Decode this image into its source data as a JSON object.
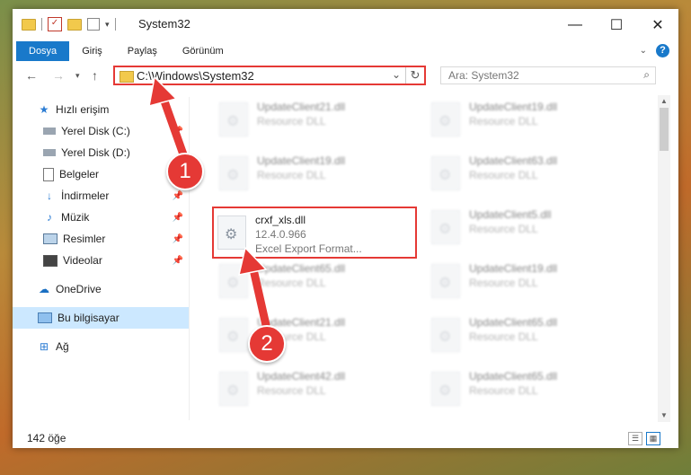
{
  "titlebar": {
    "title": "System32",
    "minimize": "—",
    "maximize": "☐",
    "close": "✕"
  },
  "ribbon": {
    "tabs": [
      "Dosya",
      "Giriş",
      "Paylaş",
      "Görünüm"
    ]
  },
  "nav": {
    "path": "C:\\Windows\\System32",
    "search_placeholder": "Ara: System32"
  },
  "sidebar": {
    "items": [
      {
        "label": "Hızlı erişim",
        "icon": "star-icon"
      },
      {
        "label": "Yerel Disk (C:)",
        "icon": "drive-icon"
      },
      {
        "label": "Yerel Disk (D:)",
        "icon": "drive-icon"
      },
      {
        "label": "Belgeler",
        "icon": "documents-icon"
      },
      {
        "label": "İndirmeler",
        "icon": "download-icon"
      },
      {
        "label": "Müzik",
        "icon": "music-icon"
      },
      {
        "label": "Resimler",
        "icon": "pictures-icon"
      },
      {
        "label": "Videolar",
        "icon": "video-icon"
      },
      {
        "label": "OneDrive",
        "icon": "cloud-icon"
      },
      {
        "label": "Bu bilgisayar",
        "icon": "computer-icon"
      },
      {
        "label": "Ağ",
        "icon": "network-icon"
      }
    ]
  },
  "files": {
    "left": [
      {
        "name": "UpdateClient21.dll",
        "type": "Resource DLL"
      },
      {
        "name": "UpdateClient19.dll",
        "type": "Resource DLL"
      },
      {
        "name": "crxf_xls.dll",
        "version": "12.4.0.966",
        "type": "Excel Export Format..."
      },
      {
        "name": "UpdateClient65.dll",
        "type": "Resource DLL"
      },
      {
        "name": "UpdateClient21.dll",
        "type": "Resource DLL"
      },
      {
        "name": "UpdateClient42.dll",
        "type": "Resource DLL"
      }
    ],
    "right": [
      {
        "name": "UpdateClient19.dll",
        "type": "Resource DLL"
      },
      {
        "name": "UpdateClient63.dll",
        "type": "Resource DLL"
      },
      {
        "name": "UpdateClient5.dll",
        "type": "Resource DLL"
      },
      {
        "name": "UpdateClient19.dll",
        "type": "Resource DLL"
      },
      {
        "name": "UpdateClient65.dll",
        "type": "Resource DLL"
      },
      {
        "name": "UpdateClient65.dll",
        "type": "Resource DLL"
      }
    ]
  },
  "status": {
    "count": "142 öğe"
  },
  "annotations": {
    "step1": "1",
    "step2": "2",
    "color": "#e53935"
  }
}
